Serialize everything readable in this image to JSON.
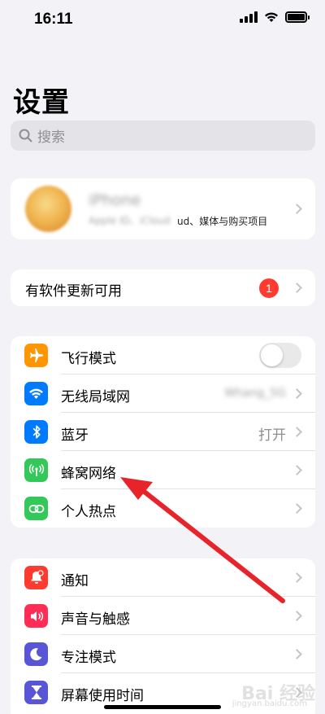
{
  "status_bar": {
    "time": "16:11"
  },
  "title": "设置",
  "search": {
    "placeholder": "搜索"
  },
  "profile": {
    "name": "iPhone",
    "subtitle_blurred": "Apple ID、iCloud",
    "subtitle_visible": "ud、媒体与购买项目"
  },
  "updates": {
    "label": "有软件更新可用",
    "badge": "1"
  },
  "network_section": [
    {
      "label": "飞行模式",
      "icon": "airplane-icon",
      "color": "#ff9500",
      "toggle": false
    },
    {
      "label": "无线局域网",
      "icon": "wifi-icon",
      "color": "#007aff",
      "value": "Whang_5G"
    },
    {
      "label": "蓝牙",
      "icon": "bluetooth-icon",
      "color": "#007aff",
      "value": "打开"
    },
    {
      "label": "蜂窝网络",
      "icon": "antenna-icon",
      "color": "#34c759"
    },
    {
      "label": "个人热点",
      "icon": "hotspot-icon",
      "color": "#34c759"
    }
  ],
  "notify_section": [
    {
      "label": "通知",
      "icon": "bell-icon",
      "color": "#ff3b30"
    },
    {
      "label": "声音与触感",
      "icon": "speaker-icon",
      "color": "#ff2d55"
    },
    {
      "label": "专注模式",
      "icon": "moon-icon",
      "color": "#5856d6"
    },
    {
      "label": "屏幕使用时间",
      "icon": "hourglass-icon",
      "color": "#5856d6"
    }
  ],
  "watermark": {
    "text": "Bai 经验",
    "sub": "jingyan.baidu.com"
  }
}
